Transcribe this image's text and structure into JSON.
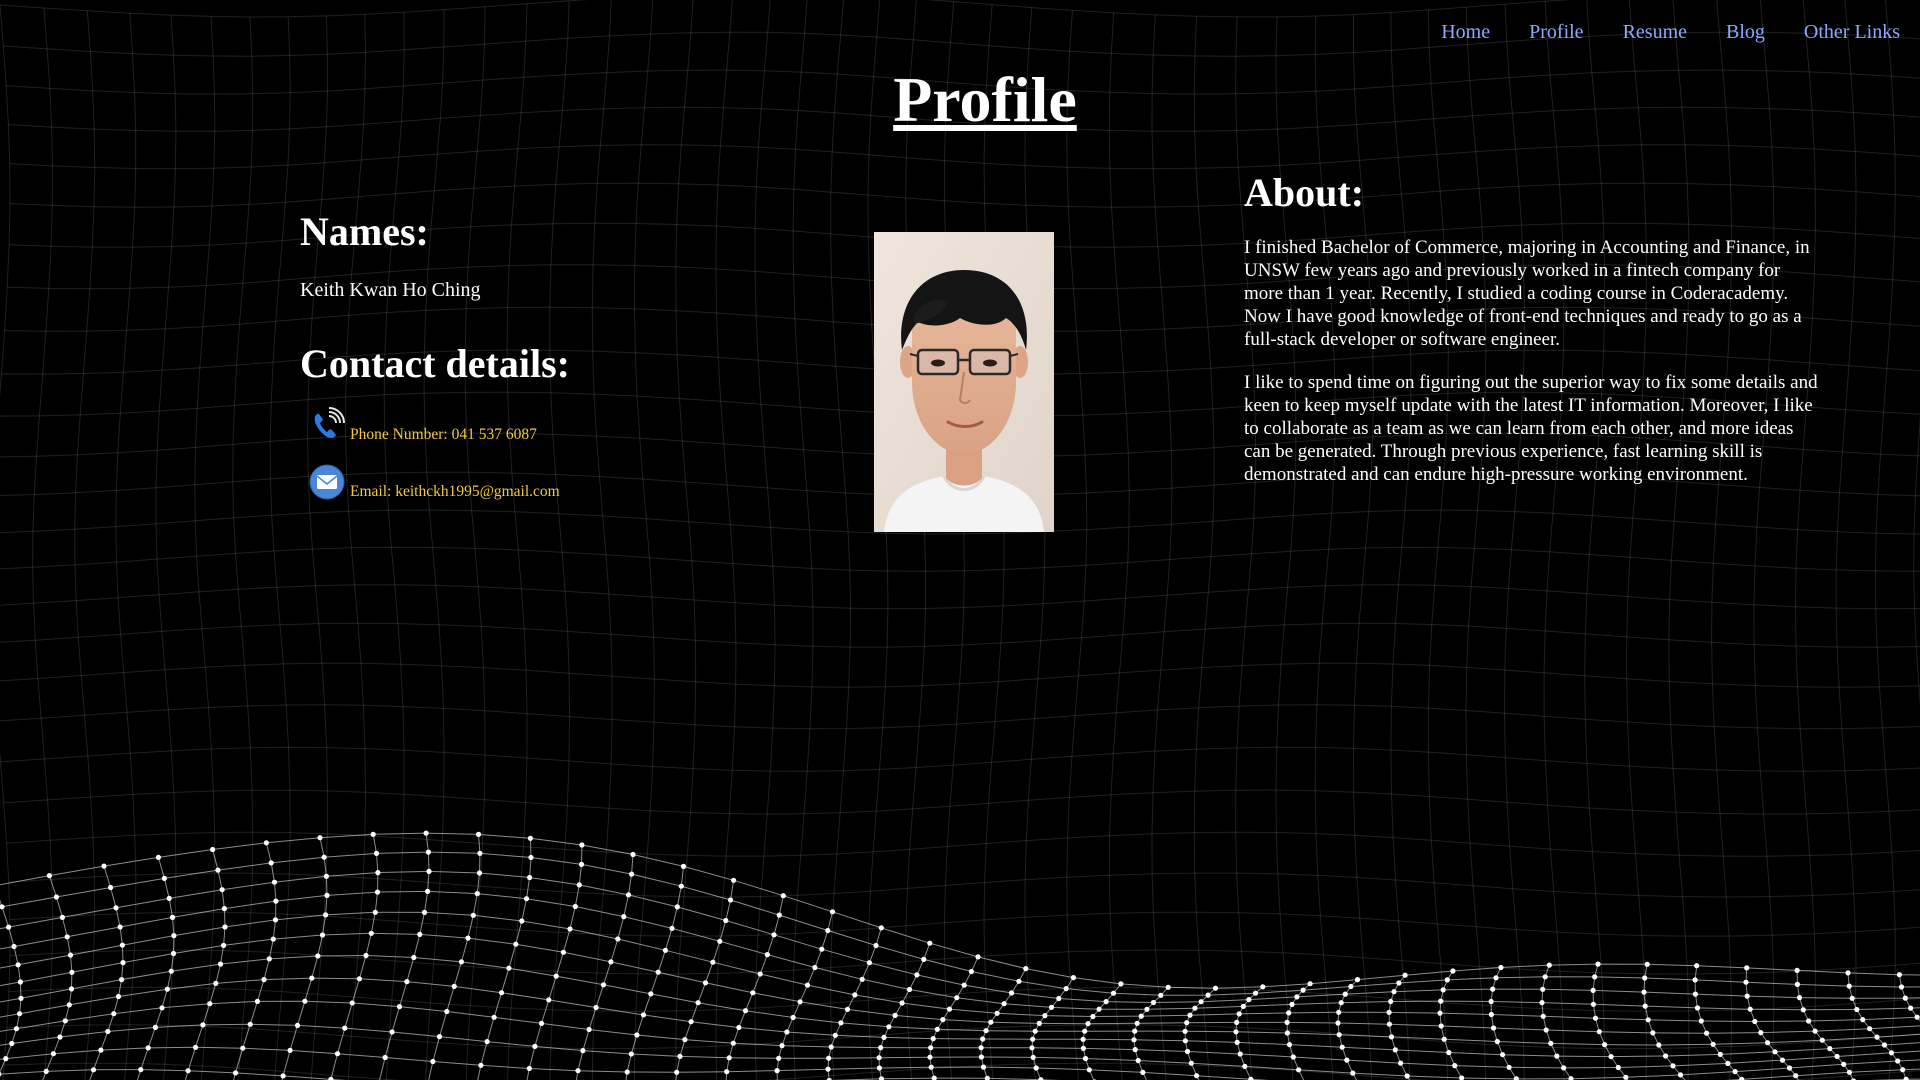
{
  "nav": {
    "items": [
      "Home",
      "Profile",
      "Resume",
      "Blog",
      "Other Links"
    ]
  },
  "page": {
    "title": "Profile"
  },
  "names": {
    "heading": "Names:",
    "value": "Keith Kwan Ho Ching"
  },
  "contact": {
    "heading": "Contact details:",
    "phone": {
      "icon": "phone-icon",
      "text": "Phone Number: 041 537 6087"
    },
    "email": {
      "icon": "envelope-icon",
      "text": "Email: keithckh1995@gmail.com"
    }
  },
  "about": {
    "heading": "About:",
    "paragraphs": [
      "I finished Bachelor of Commerce, majoring in Accounting and Finance, in UNSW few years ago and previously worked in a fintech company for more than 1 year. Recently, I studied a coding course in Coderacademy. Now I have good knowledge of front-end techniques and ready to go as a full-stack developer or software engineer.",
      "I like to spend time on figuring out the superior way to fix some details and keen to keep myself update with the latest IT information. Moreover, I like to collaborate as a team as we can learn from each other, and more ideas can be generated. Through previous experience, fast learning skill is demonstrated and can endure high-pressure working environment."
    ]
  },
  "colors": {
    "background": "#000000",
    "nav_link": "#8fa8ff",
    "contact_text": "#f5c842",
    "mesh": "#ffffff"
  }
}
